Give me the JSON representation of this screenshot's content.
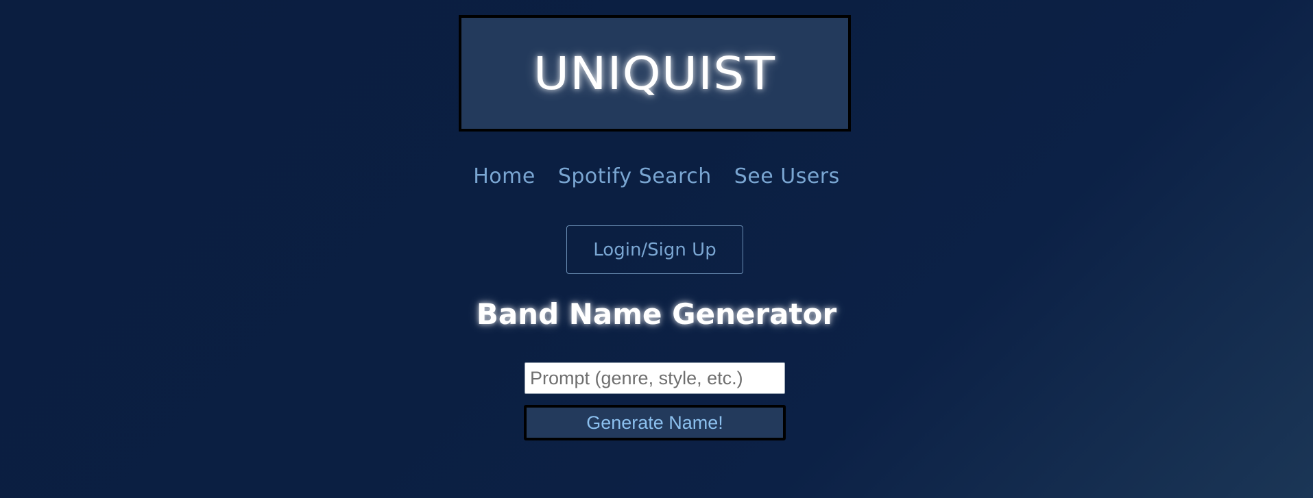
{
  "header": {
    "logo_text": "UNIQUIST"
  },
  "nav": {
    "items": [
      {
        "label": "Home"
      },
      {
        "label": "Spotify Search"
      },
      {
        "label": "See Users"
      }
    ]
  },
  "auth": {
    "login_label": "Login/Sign Up"
  },
  "generator": {
    "title": "Band Name Generator",
    "prompt_placeholder": "Prompt (genre, style, etc.)",
    "prompt_value": "",
    "button_label": "Generate Name!"
  },
  "colors": {
    "background": "#0b1f42",
    "panel": "#233a5c",
    "link": "#7aa6d2",
    "button_text": "#8cc0ee",
    "heading": "#ffffff"
  }
}
